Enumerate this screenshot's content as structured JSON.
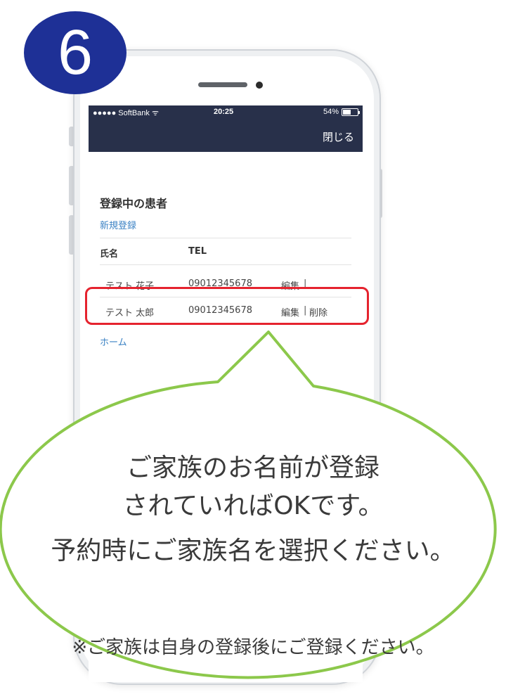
{
  "step_number": "6",
  "status_bar": {
    "carrier": "●●●●● SoftBank ᯤ",
    "time": "20:25",
    "battery": "54%",
    "battery_level": 0.54
  },
  "navbar": {
    "close_label": "閉じる"
  },
  "page": {
    "title": "登録中の患者",
    "new_registration_link": "新規登録",
    "table_headers": {
      "name": "氏名",
      "tel": "TEL"
    },
    "rows": [
      {
        "name": "テスト 花子",
        "tel": "09012345678",
        "edit": "編集",
        "separator": "|",
        "delete": ""
      },
      {
        "name": "テスト 太郎",
        "tel": "09012345678",
        "edit": "編集",
        "separator": "|",
        "delete": "削除"
      }
    ],
    "home_link": "ホーム"
  },
  "bubble": {
    "line1": "ご家族のお名前が登録",
    "line2": "されていればOKです。",
    "line3": "予約時にご家族名を選択ください。",
    "note": "※ご家族は自身の登録後にご登録ください。"
  },
  "colors": {
    "badge": "#1e3096",
    "navbar": "#28304a",
    "link": "#3b82c4",
    "highlight_border": "#e5232e",
    "bubble_border": "#8cc84b"
  }
}
